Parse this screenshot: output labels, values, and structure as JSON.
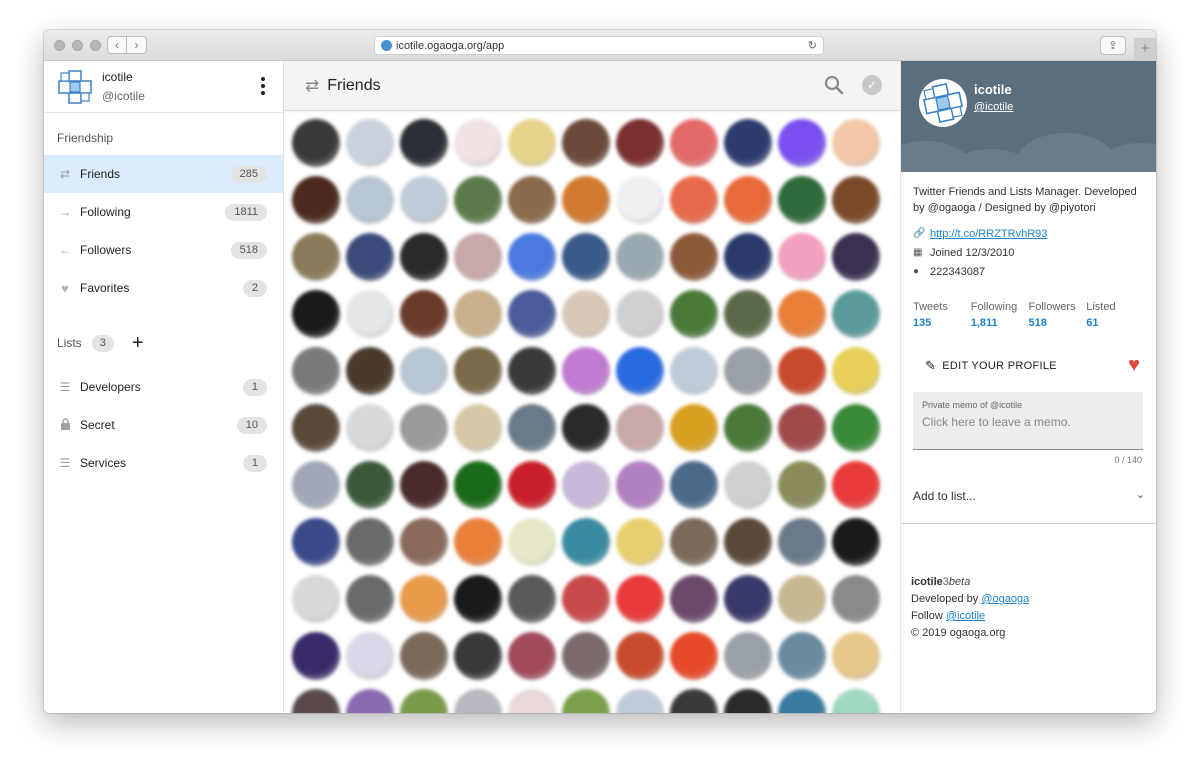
{
  "browser": {
    "url": "icotile.ogaoga.org/app"
  },
  "account": {
    "name": "icotile",
    "handle": "@icotile"
  },
  "sidebar": {
    "friendship_label": "Friendship",
    "items": [
      {
        "label": "Friends",
        "count": "285",
        "icon": "swap-icon",
        "active": true
      },
      {
        "label": "Following",
        "count": "1811",
        "icon": "arrow-right-icon"
      },
      {
        "label": "Followers",
        "count": "518",
        "icon": "arrow-left-icon"
      },
      {
        "label": "Favorites",
        "count": "2",
        "icon": "heart-icon"
      }
    ],
    "lists_label": "Lists",
    "lists_count": "3",
    "lists": [
      {
        "label": "Developers",
        "count": "1",
        "icon": "list-icon"
      },
      {
        "label": "Secret",
        "count": "10",
        "icon": "lock-icon"
      },
      {
        "label": "Services",
        "count": "1",
        "icon": "list-icon"
      }
    ]
  },
  "center": {
    "title": "Friends"
  },
  "profile": {
    "name": "icotile",
    "handle": "@icotile",
    "bio": "Twitter Friends and Lists Manager.  Developed by @ogaoga / Designed by @piyotori",
    "link": "http://t.co/RRZTRvhR93",
    "joined": "Joined 12/3/2010",
    "user_id": "222343087",
    "stats": [
      {
        "label": "Tweets",
        "value": "135"
      },
      {
        "label": "Following",
        "value": "1,811"
      },
      {
        "label": "Followers",
        "value": "518"
      },
      {
        "label": "Listed",
        "value": "61"
      }
    ],
    "edit_label": "EDIT YOUR PROFILE",
    "memo_label": "Private memo of @icotile",
    "memo_placeholder": "Click here to leave a memo.",
    "memo_counter": "0 / 140",
    "add_to_list": "Add to list..."
  },
  "footer": {
    "app_name": "icotile",
    "version": "3",
    "beta": "beta",
    "developed_by_prefix": "Developed by ",
    "developer": "@ogaoga",
    "follow_prefix": "Follow ",
    "follow_handle": "@icotile",
    "copyright": "© 2019 ogaoga.org"
  },
  "colors": {
    "accent": "#1d82cf",
    "active_bg": "#dcebfd",
    "banner": "#5a6e7d",
    "heart": "#e14a3c"
  }
}
